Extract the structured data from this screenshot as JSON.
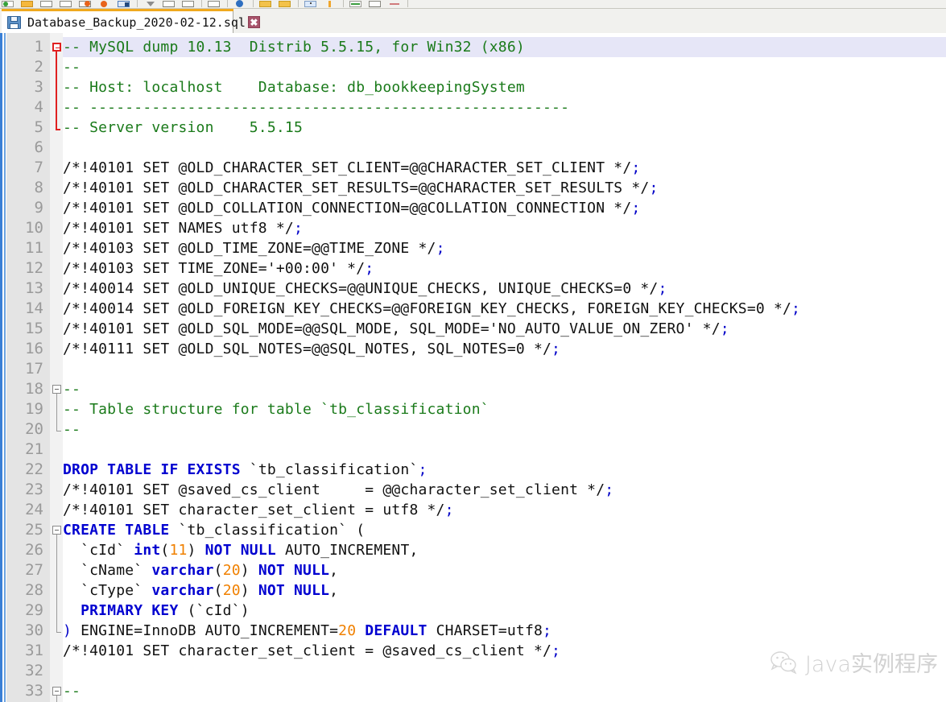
{
  "window": {
    "app": "Notepad++",
    "accent_tab": "#f0a91e",
    "line_highlight": "#e6e6f7"
  },
  "toolbar": {
    "icons": [
      "new-file-icon",
      "save-icon",
      "open-folder-icon",
      "save-all-icon",
      "print-icon",
      "cut-icon",
      "copy-icon",
      "paste-icon",
      "undo-icon",
      "redo-icon",
      "find-icon",
      "replace-icon",
      "zoom-in-icon",
      "zoom-out-icon",
      "sync-scroll-icon",
      "word-wrap-icon",
      "show-all-chars-icon",
      "indent-guide-icon",
      "macro-record-icon",
      "macro-play-icon",
      "run-icon",
      "tab-settings-icon",
      "close-icon"
    ]
  },
  "tab": {
    "icon": "floppy-disk-icon",
    "label": "Database_Backup_2020-02-12.sql",
    "close_label": "✖"
  },
  "watermark": {
    "icon": "wechat-icon",
    "text": "Java实例程序"
  },
  "editor": {
    "colors": {
      "comment": "#1a7a1a",
      "keyword": "#0000d0",
      "number": "#f08000",
      "operator": "#0000c8",
      "plain": "#111111",
      "gutter_bg": "#e4e4e4",
      "line_number": "#9a9a9a"
    },
    "current_line": 1,
    "first_visible_line": 1,
    "last_visible_line": 33,
    "lines": [
      {
        "n": 1,
        "fold": "start-red",
        "tokens": [
          [
            "cm",
            "-- MySQL dump 10.13  Distrib 5.5.15, for Win32 (x86)"
          ]
        ]
      },
      {
        "n": 2,
        "fold": "bar-red",
        "tokens": [
          [
            "cm",
            "--"
          ]
        ]
      },
      {
        "n": 3,
        "fold": "bar-red",
        "tokens": [
          [
            "cm",
            "-- Host: localhost    Database: db_bookkeepingSystem"
          ]
        ]
      },
      {
        "n": 4,
        "fold": "bar-red",
        "tokens": [
          [
            "cm",
            "-- ------------------------------------------------------"
          ]
        ]
      },
      {
        "n": 5,
        "fold": "end-red",
        "tokens": [
          [
            "cm",
            "-- Server version\t5.5.15"
          ]
        ]
      },
      {
        "n": 6,
        "fold": "",
        "tokens": []
      },
      {
        "n": 7,
        "fold": "",
        "tokens": [
          [
            "pl",
            "/*!40101 SET @OLD_CHARACTER_SET_CLIENT=@@CHARACTER_SET_CLIENT */"
          ],
          [
            "op",
            ";"
          ]
        ]
      },
      {
        "n": 8,
        "fold": "",
        "tokens": [
          [
            "pl",
            "/*!40101 SET @OLD_CHARACTER_SET_RESULTS=@@CHARACTER_SET_RESULTS */"
          ],
          [
            "op",
            ";"
          ]
        ]
      },
      {
        "n": 9,
        "fold": "",
        "tokens": [
          [
            "pl",
            "/*!40101 SET @OLD_COLLATION_CONNECTION=@@COLLATION_CONNECTION */"
          ],
          [
            "op",
            ";"
          ]
        ]
      },
      {
        "n": 10,
        "fold": "",
        "tokens": [
          [
            "pl",
            "/*!40101 SET NAMES utf8 */"
          ],
          [
            "op",
            ";"
          ]
        ]
      },
      {
        "n": 11,
        "fold": "",
        "tokens": [
          [
            "pl",
            "/*!40103 SET @OLD_TIME_ZONE=@@TIME_ZONE */"
          ],
          [
            "op",
            ";"
          ]
        ]
      },
      {
        "n": 12,
        "fold": "",
        "tokens": [
          [
            "pl",
            "/*!40103 SET TIME_ZONE='+00:00' */"
          ],
          [
            "op",
            ";"
          ]
        ]
      },
      {
        "n": 13,
        "fold": "",
        "tokens": [
          [
            "pl",
            "/*!40014 SET @OLD_UNIQUE_CHECKS=@@UNIQUE_CHECKS, UNIQUE_CHECKS=0 */"
          ],
          [
            "op",
            ";"
          ]
        ]
      },
      {
        "n": 14,
        "fold": "",
        "tokens": [
          [
            "pl",
            "/*!40014 SET @OLD_FOREIGN_KEY_CHECKS=@@FOREIGN_KEY_CHECKS, FOREIGN_KEY_CHECKS=0 */"
          ],
          [
            "op",
            ";"
          ]
        ]
      },
      {
        "n": 15,
        "fold": "",
        "tokens": [
          [
            "pl",
            "/*!40101 SET @OLD_SQL_MODE=@@SQL_MODE, SQL_MODE='NO_AUTO_VALUE_ON_ZERO' */"
          ],
          [
            "op",
            ";"
          ]
        ]
      },
      {
        "n": 16,
        "fold": "",
        "tokens": [
          [
            "pl",
            "/*!40111 SET @OLD_SQL_NOTES=@@SQL_NOTES, SQL_NOTES=0 */"
          ],
          [
            "op",
            ";"
          ]
        ]
      },
      {
        "n": 17,
        "fold": "",
        "tokens": []
      },
      {
        "n": 18,
        "fold": "start-gray",
        "tokens": [
          [
            "cm",
            "--"
          ]
        ]
      },
      {
        "n": 19,
        "fold": "bar-gray",
        "tokens": [
          [
            "cm",
            "-- Table structure for table `tb_classification`"
          ]
        ]
      },
      {
        "n": 20,
        "fold": "end-gray",
        "tokens": [
          [
            "cm",
            "--"
          ]
        ]
      },
      {
        "n": 21,
        "fold": "",
        "tokens": []
      },
      {
        "n": 22,
        "fold": "",
        "tokens": [
          [
            "kw",
            "DROP TABLE IF EXISTS"
          ],
          [
            "pl",
            " `tb_classification`"
          ],
          [
            "op",
            ";"
          ]
        ]
      },
      {
        "n": 23,
        "fold": "",
        "tokens": [
          [
            "pl",
            "/*!40101 SET @saved_cs_client     = @@character_set_client */"
          ],
          [
            "op",
            ";"
          ]
        ]
      },
      {
        "n": 24,
        "fold": "",
        "tokens": [
          [
            "pl",
            "/*!40101 SET character_set_client = utf8 */"
          ],
          [
            "op",
            ";"
          ]
        ]
      },
      {
        "n": 25,
        "fold": "start-gray",
        "tokens": [
          [
            "kw",
            "CREATE TABLE"
          ],
          [
            "pl",
            " `tb_classification` ("
          ]
        ]
      },
      {
        "n": 26,
        "fold": "bar-gray",
        "tokens": [
          [
            "pl",
            "  `cId` "
          ],
          [
            "kw",
            "int"
          ],
          [
            "pl",
            "("
          ],
          [
            "num",
            "11"
          ],
          [
            "pl",
            ") "
          ],
          [
            "kw",
            "NOT NULL"
          ],
          [
            "pl",
            " AUTO_INCREMENT,"
          ]
        ]
      },
      {
        "n": 27,
        "fold": "bar-gray",
        "tokens": [
          [
            "pl",
            "  `cName` "
          ],
          [
            "kw",
            "varchar"
          ],
          [
            "pl",
            "("
          ],
          [
            "num",
            "20"
          ],
          [
            "pl",
            ") "
          ],
          [
            "kw",
            "NOT NULL"
          ],
          [
            "pl",
            ","
          ]
        ]
      },
      {
        "n": 28,
        "fold": "bar-gray",
        "tokens": [
          [
            "pl",
            "  `cType` "
          ],
          [
            "kw",
            "varchar"
          ],
          [
            "pl",
            "("
          ],
          [
            "num",
            "20"
          ],
          [
            "pl",
            ") "
          ],
          [
            "kw",
            "NOT NULL"
          ],
          [
            "pl",
            ","
          ]
        ]
      },
      {
        "n": 29,
        "fold": "bar-gray",
        "tokens": [
          [
            "pl",
            "  "
          ],
          [
            "kw",
            "PRIMARY KEY"
          ],
          [
            "pl",
            " (`cId`)"
          ]
        ]
      },
      {
        "n": 30,
        "fold": "end-gray",
        "tokens": [
          [
            "op",
            ")"
          ],
          [
            "pl",
            " ENGINE=InnoDB AUTO_INCREMENT="
          ],
          [
            "num",
            "20"
          ],
          [
            "pl",
            " "
          ],
          [
            "kw",
            "DEFAULT"
          ],
          [
            "pl",
            " CHARSET=utf8"
          ],
          [
            "op",
            ";"
          ]
        ]
      },
      {
        "n": 31,
        "fold": "",
        "tokens": [
          [
            "pl",
            "/*!40101 SET character_set_client = @saved_cs_client */"
          ],
          [
            "op",
            ";"
          ]
        ]
      },
      {
        "n": 32,
        "fold": "",
        "tokens": []
      },
      {
        "n": 33,
        "fold": "start-gray",
        "tokens": [
          [
            "cm",
            "--"
          ]
        ]
      }
    ]
  }
}
